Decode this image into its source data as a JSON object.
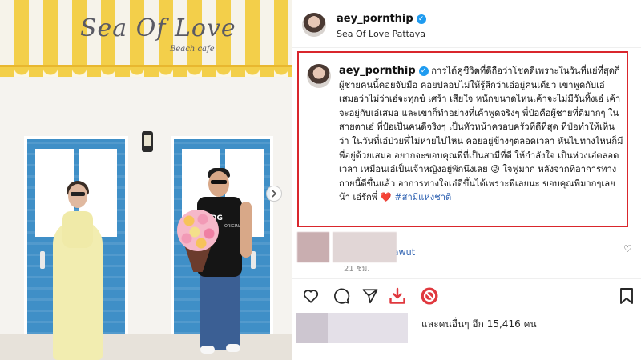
{
  "photo": {
    "sign_title": "Sea Of Love",
    "sign_subtitle": "Beach cafe",
    "shirt_logo": "DG",
    "shirt_logo_sub": "ORIGINALS",
    "next_icon": "chevron-right-icon"
  },
  "post": {
    "username": "aey_pornthip",
    "verified": true,
    "location": "Sea Of Love Pattaya",
    "caption": {
      "username": "aey_pornthip",
      "text": "การได้คู่ชีวิตที่ดีถือว่าโชคดีเพราะในวันที่แย่ที่สุดก็ผู้ชายคนนี้คอยจับมือ คอยปลอบไม่ให้รู้สึกว่าเอ๋อยู่คนเดียว เขาพูดกับเอ๋เสมอว่าไม่ว่าเอ๋จะทุกข์ เศร้า เสียใจ หนักขนาดไหนเค้าจะไม่มีวันทิ้งเอ๋ เค้าจะอยู่กับเอ๋เสมอ และเขาก็ทำอย่างที่เค้าพูดจริงๆ พี่ป๋อคือผู้ชายที่ดีมากๆ ในสายตาเอ๋ พี่ป๋อเป็นคนดีจริงๆ เป็นหัวหน้าครอบครัวที่ดีที่สุด ที่ป๋อทำให้เห็นว่า ในวันที่เอ๋ป่วยพี่ไม่หายไปไหน คอยอยู่ข้างๆตลอดเวลา หันไปทางไหนก็มีพี่อยู่ด้วยเสมอ อยากจะขอบคุณพี่ที่เป็นสามีที่ดี ให้กำลังใจ เป็นห่วงเอ๋ตลอดเวลา เหมือนเอ๋เป็นเจ้าหญิงอยู่พักนึงเลย 😜 ใจฟูมาก หลังจากที่อาการทางกายนี้ดีขึ้นแล้ว อาการทางใจเอ๋ดีขึ้นได้เพราะพี่เลยนะ ขอบคุณพี่มากๆเลยน้า เอ๋รักพี่",
      "heart": "❤️",
      "hashtag": "#สามีแห่งชาติ",
      "mention": "@poh_natthawut",
      "time": "21 ชม."
    },
    "likes_text": "และคนอื่นๆ อีก 15,416 คน",
    "icons": {
      "like": "heart-icon",
      "comment": "comment-icon",
      "share": "send-icon",
      "download": "download-icon",
      "blocked": "blocked-icon",
      "save": "bookmark-icon"
    },
    "colors": {
      "highlight_border": "#d9262c",
      "link": "#2b5fb0",
      "verified": "#1e9bf0",
      "download": "#e0383e"
    }
  }
}
